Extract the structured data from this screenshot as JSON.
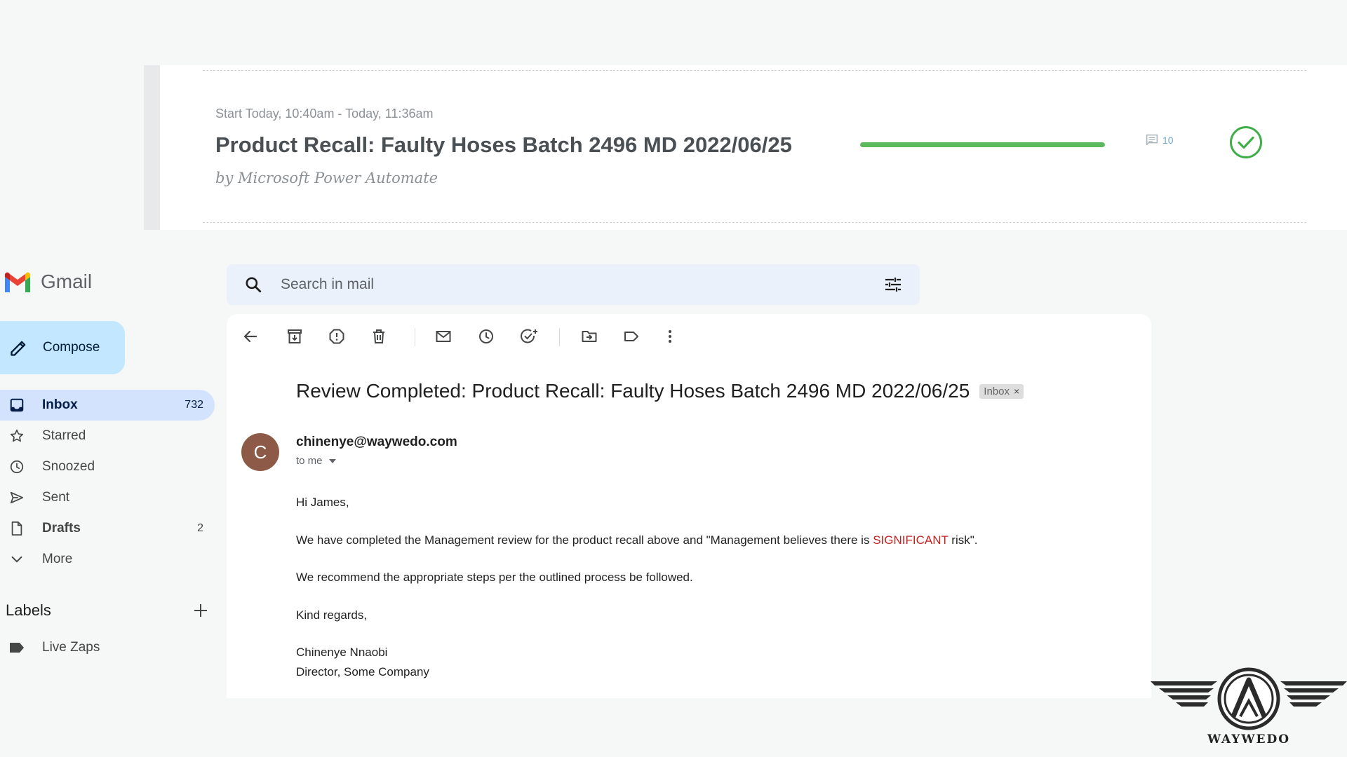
{
  "task_card": {
    "time_range": "Start Today, 10:40am - Today, 11:36am",
    "title": "Product Recall: Faulty Hoses Batch 2496 MD 2022/06/25",
    "author": "by Microsoft Power Automate",
    "progress_percent": 100,
    "progress_color": "#5cb85c",
    "comment_count": "10",
    "status_icon": "check-circle-icon",
    "status_color": "#3fae49"
  },
  "gmail": {
    "app_name": "Gmail",
    "compose_label": "Compose",
    "search_placeholder": "Search in mail",
    "nav": [
      {
        "label": "Inbox",
        "count": "732",
        "icon": "inbox-icon",
        "active": true,
        "bold": true
      },
      {
        "label": "Starred",
        "count": "",
        "icon": "star-icon",
        "active": false,
        "bold": false
      },
      {
        "label": "Snoozed",
        "count": "",
        "icon": "clock-icon",
        "active": false,
        "bold": false
      },
      {
        "label": "Sent",
        "count": "",
        "icon": "send-icon",
        "active": false,
        "bold": false
      },
      {
        "label": "Drafts",
        "count": "2",
        "icon": "draft-icon",
        "active": false,
        "bold": true
      },
      {
        "label": "More",
        "count": "",
        "icon": "chevron-down-icon",
        "active": false,
        "bold": false
      }
    ],
    "labels_heading": "Labels",
    "labels": [
      {
        "label": "Live Zaps",
        "icon": "label-icon"
      }
    ],
    "toolbar_icons": [
      "back-arrow-icon",
      "archive-icon",
      "report-spam-icon",
      "delete-icon",
      "mark-unread-icon",
      "snooze-icon",
      "add-task-icon",
      "move-to-icon",
      "labels-icon",
      "more-vert-icon"
    ],
    "email": {
      "subject": "Review Completed: Product Recall: Faulty Hoses Batch 2496 MD 2022/06/25",
      "chip_label": "Inbox",
      "chip_close": "×",
      "sender_initial": "C",
      "sender_email": "chinenye@waywedo.com",
      "recipient": "to me",
      "greeting": "Hi James,",
      "para1_before": "We have completed the Management review for the product recall above and \"Management believes there is ",
      "para1_highlight": "SIGNIFICANT",
      "para1_after": " risk\".",
      "para2": "We recommend the appropriate steps per the outlined process be followed.",
      "closing": "Kind regards,",
      "signature_name": "Chinenye Nnaobi",
      "signature_title": "Director, Some Company"
    }
  },
  "brand": {
    "name": "WAYWEDO"
  },
  "colors": {
    "accent": "#c2e7ff",
    "nav_active": "#d3e3fd",
    "search_bg": "#eaf1fb",
    "highlight_red": "#c5221f",
    "avatar": "#8d5a47"
  }
}
